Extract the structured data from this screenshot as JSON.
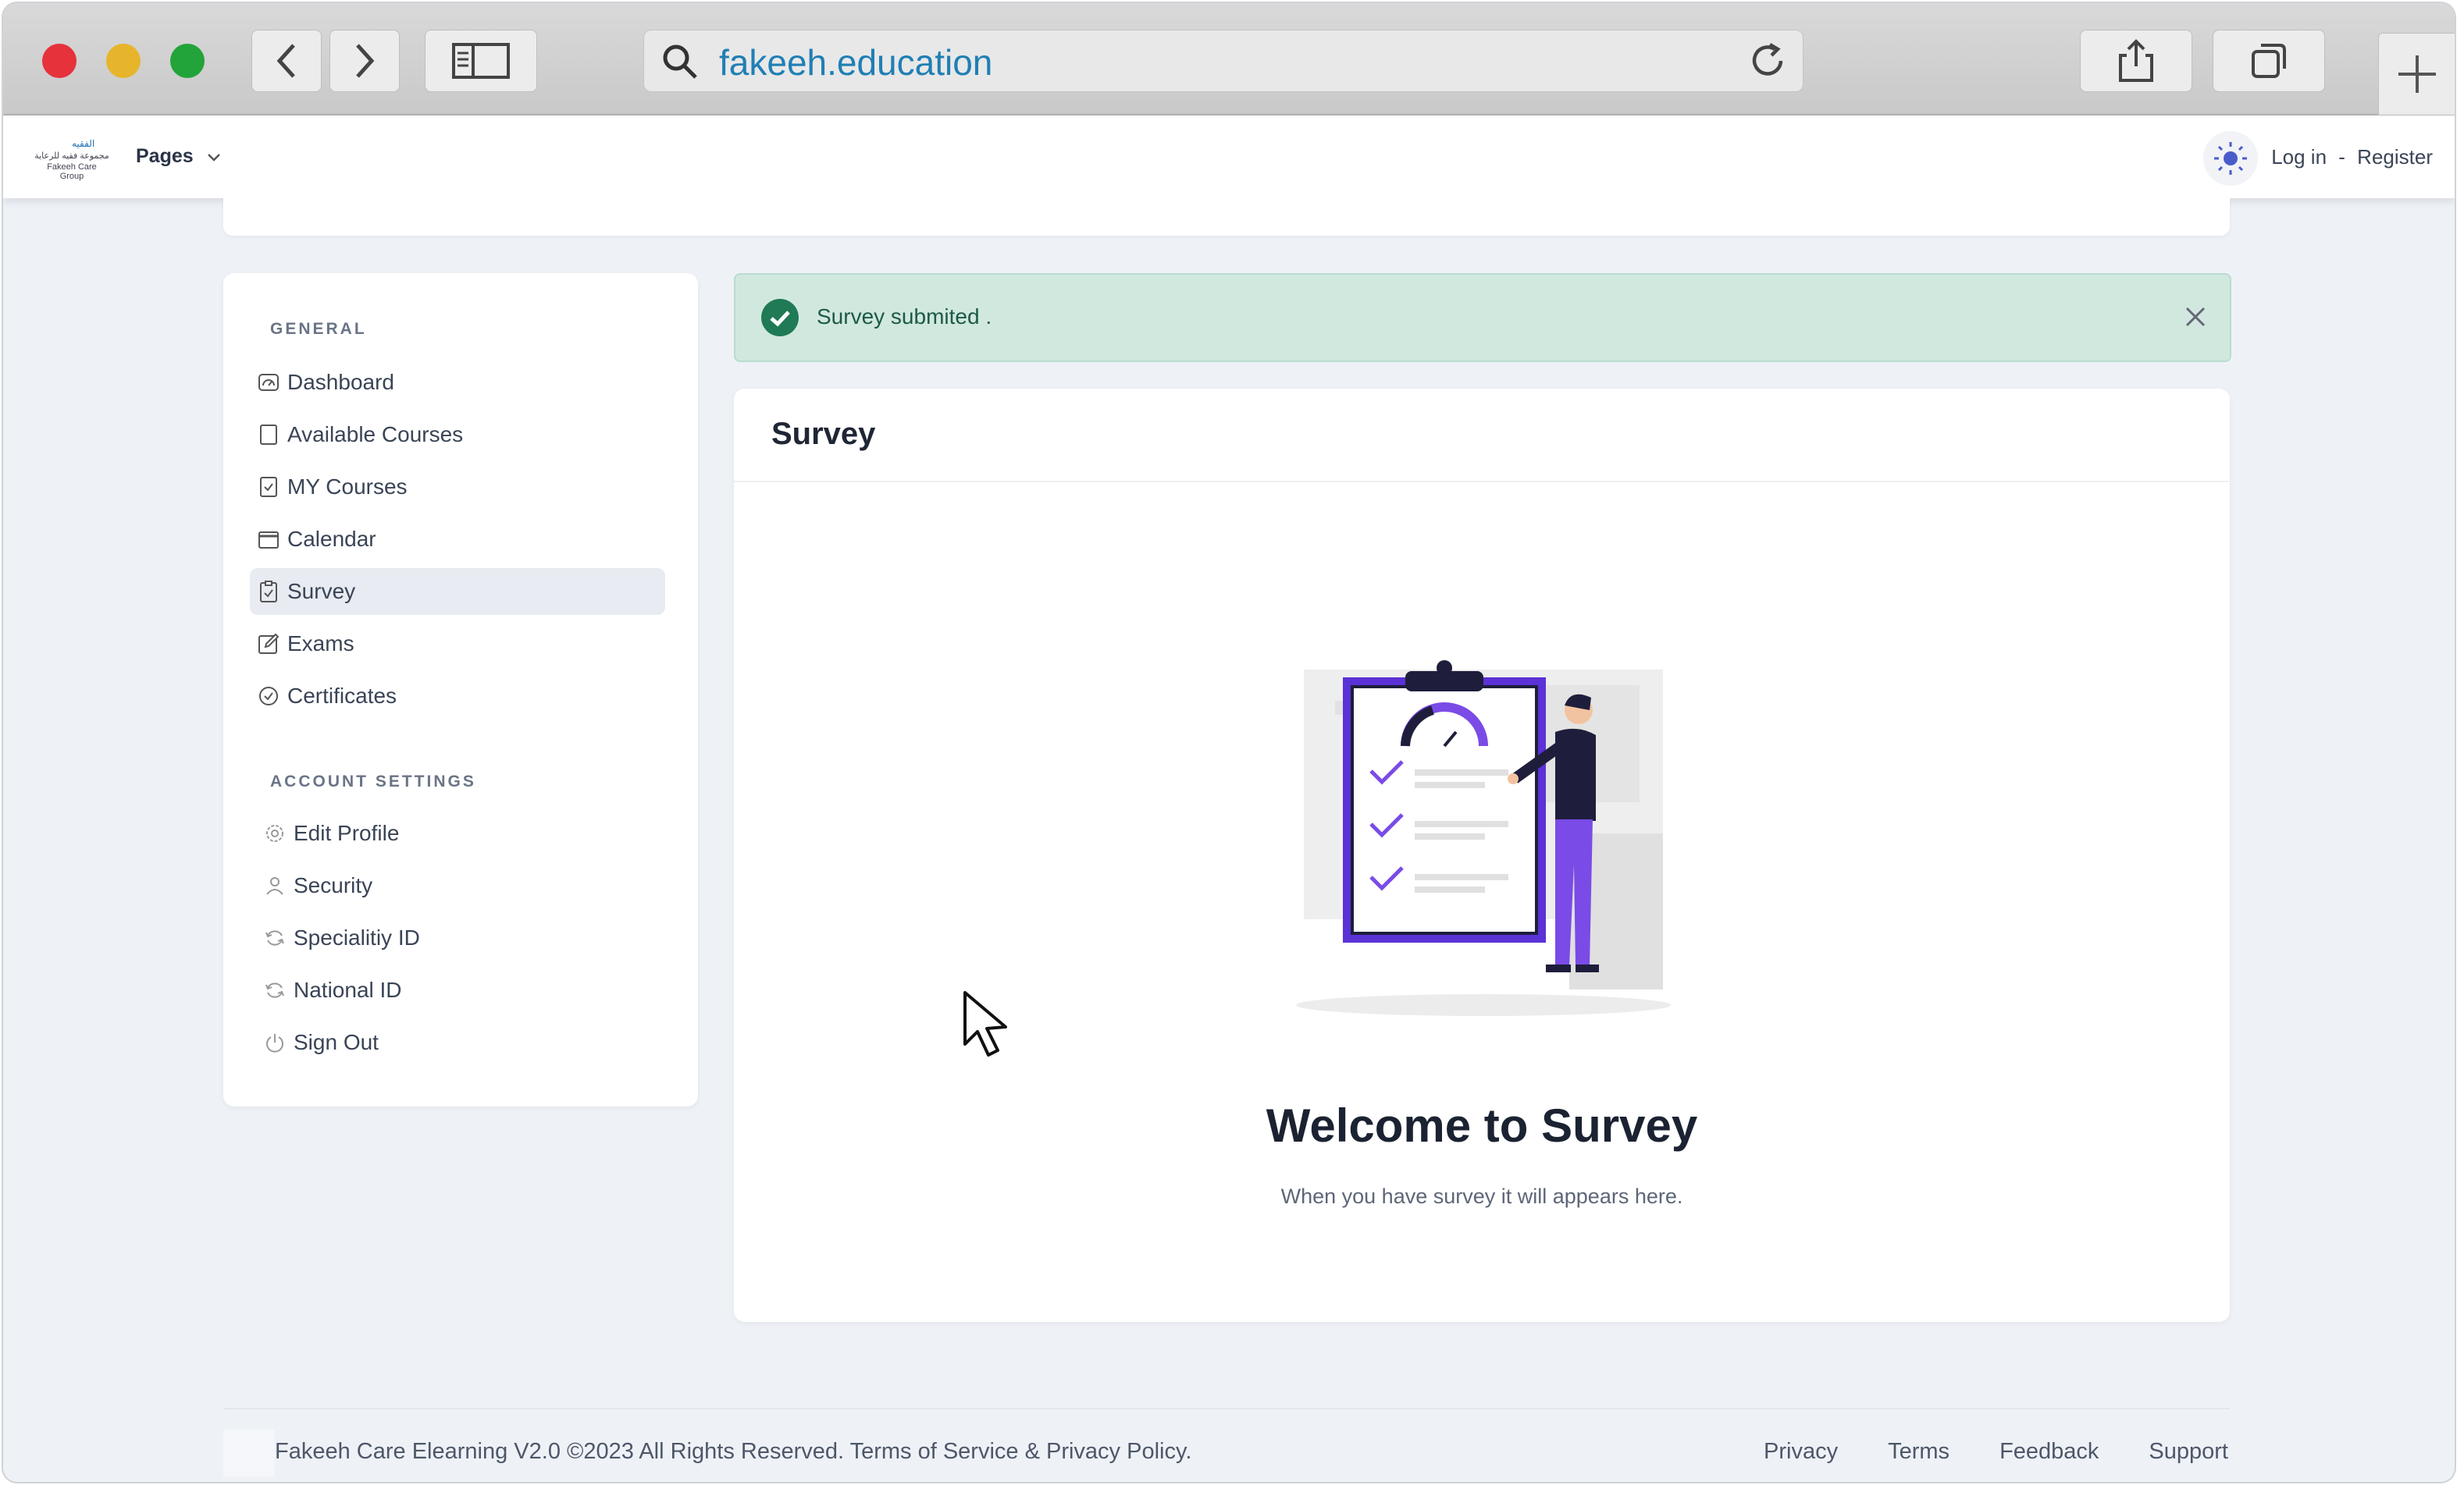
{
  "browser": {
    "url": "fakeeh.education"
  },
  "header": {
    "logo_line1": "الفقيه",
    "logo_line2": "مجموعة فقيه للرعاية",
    "logo_line3": "Fakeeh Care Group",
    "pages_label": "Pages",
    "login_label": "Log in",
    "separator": "-",
    "register_label": "Register"
  },
  "sidebar": {
    "general_title": "GENERAL",
    "general_items": [
      {
        "label": "Dashboard",
        "icon": "dashboard-icon"
      },
      {
        "label": "Available Courses",
        "icon": "document-icon"
      },
      {
        "label": "MY Courses",
        "icon": "checked-document-icon"
      },
      {
        "label": "Calendar",
        "icon": "calendar-icon"
      },
      {
        "label": "Survey",
        "icon": "clipboard-icon",
        "active": true
      },
      {
        "label": "Exams",
        "icon": "edit-icon"
      },
      {
        "label": "Certificates",
        "icon": "check-circle-icon"
      }
    ],
    "account_title": "ACCOUNT SETTINGS",
    "account_items": [
      {
        "label": "Edit Profile",
        "icon": "gear-icon"
      },
      {
        "label": "Security",
        "icon": "user-icon"
      },
      {
        "label": "Specialitiy ID",
        "icon": "refresh-icon"
      },
      {
        "label": "National ID",
        "icon": "refresh-icon"
      },
      {
        "label": "Sign Out",
        "icon": "power-icon"
      }
    ]
  },
  "alert": {
    "message": "Survey submited ."
  },
  "survey": {
    "title": "Survey",
    "welcome": "Welcome to Survey",
    "subtitle": "When you have survey it will appears here."
  },
  "footer": {
    "copyright": "Fakeeh Care Elearning V2.0 ©2023 All Rights Reserved. Terms of Service & Privacy Policy.",
    "links": [
      "Privacy",
      "Terms",
      "Feedback",
      "Support"
    ]
  },
  "colors": {
    "accent": "#7a4be6",
    "success": "#1f7a55",
    "alert_bg": "#d1e8df"
  }
}
